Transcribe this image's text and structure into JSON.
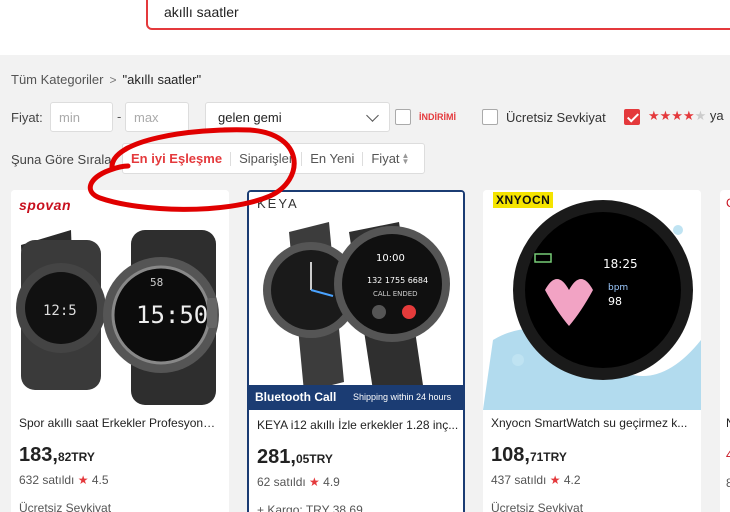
{
  "search": {
    "query": "akıllı saatler"
  },
  "breadcrumb": {
    "root": "Tüm Kategoriler",
    "separator": ">",
    "current": "\"akıllı saatler\""
  },
  "filters": {
    "price_label": "Fiyat:",
    "min_placeholder": "min",
    "dash": "-",
    "max_placeholder": "max",
    "ship_from_selected": "gelen gemi",
    "discount_label": "İNDİRİMİ",
    "discount_checked": false,
    "free_shipping_label": "Ücretsiz Sevkiyat",
    "free_shipping_checked": false,
    "rating_checked": true,
    "rating_stars_on": "★★★★",
    "rating_stars_off": "★",
    "rating_suffix": "ya"
  },
  "sort": {
    "label": "Şuna Göre Sırala:",
    "options": [
      "En iyi Eşleşme",
      "Siparişler",
      "En Yeni",
      "Fiyat"
    ],
    "active": "En iyi Eşleşme"
  },
  "products": [
    {
      "brand": "spovan",
      "title": "Spor akıllı saat Erkekler Profesyonel...",
      "price_int": "183,",
      "price_dec": "82TRY",
      "sold": "632 satıldı",
      "rating": "4.5",
      "shipping": "Ücretsiz Sevkiyat",
      "watch_time": "15:50"
    },
    {
      "brand": "KEYA",
      "title": "KEYA i12 akıllı İzle erkekler 1.28 inç...",
      "price_int": "281,",
      "price_dec": "05TRY",
      "sold": "62 satıldı",
      "rating": "4.9",
      "shipping": "+ Kargo: TRY 38,69",
      "banner_left": "Bluetooth Call",
      "banner_right": "Shipping within 24 hours",
      "watch_time": "10:00",
      "watch_number": "132 1755 6684",
      "watch_status": "CALL ENDED"
    },
    {
      "brand": "XNYOCN",
      "title": "Xnyocn SmartWatch su geçirmez k...",
      "price_int": "108,",
      "price_dec": "71TRY",
      "sold": "437 satıldı",
      "rating": "4.2",
      "shipping": "Ücretsiz Sevkiyat",
      "watch_time": "18:25",
      "watch_bpm_label": "bpm",
      "watch_bpm": "98"
    }
  ],
  "edge_card": {
    "line1": "C",
    "line2": "N",
    "line3": "4",
    "line4": "8"
  },
  "colors": {
    "accent": "#e4393c",
    "banner": "#1b3c73",
    "rating_star": "#e4393c"
  }
}
